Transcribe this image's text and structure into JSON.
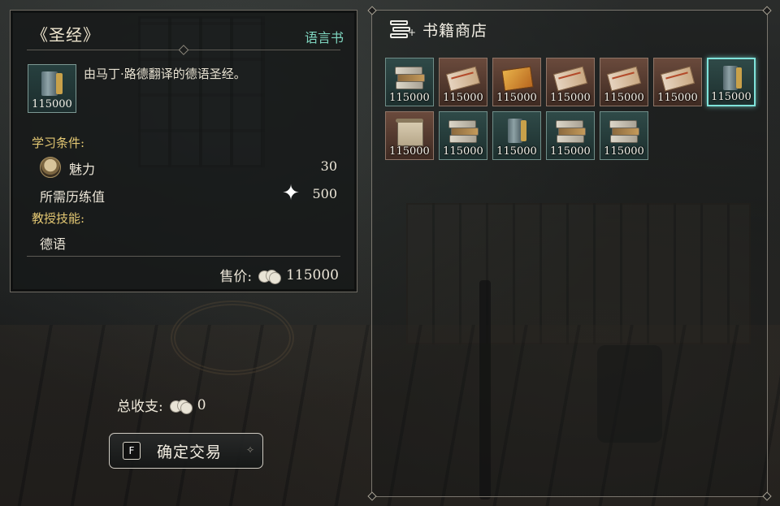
{
  "item_panel": {
    "title": "《圣经》",
    "category": "语言书",
    "description": "由马丁·路德翻译的德语圣经。",
    "thumb_price": "115000",
    "requirements_heading": "学习条件:",
    "charm_label": "魅力",
    "charm_value": "30",
    "exp_label": "所需历练值",
    "exp_value": "500",
    "skill_heading": "教授技能:",
    "skill_value": "德语",
    "price_label": "售价:",
    "price_value": "115000"
  },
  "footer": {
    "total_label": "总收支:",
    "total_value": "0",
    "confirm_key": "F",
    "confirm_label": "确定交易"
  },
  "shop": {
    "title": "书籍商店",
    "items": [
      {
        "price": "115000",
        "art": "stack"
      },
      {
        "price": "115000",
        "art": "scroll"
      },
      {
        "price": "115000",
        "art": "map"
      },
      {
        "price": "115000",
        "art": "scroll"
      },
      {
        "price": "115000",
        "art": "scroll"
      },
      {
        "price": "115000",
        "art": "scroll"
      },
      {
        "price": "115000",
        "art": "bible",
        "selected": true
      },
      {
        "price": "115000",
        "art": "parch"
      },
      {
        "price": "115000",
        "art": "stack"
      },
      {
        "price": "115000",
        "art": "bible"
      },
      {
        "price": "115000",
        "art": "stack"
      },
      {
        "price": "115000",
        "art": "stack"
      }
    ]
  },
  "colors": {
    "accent_teal": "#7fd6c0",
    "heading_gold": "#e4c873",
    "selected_border": "#7fe3da"
  },
  "icons": [
    "books-icon",
    "charm-icon",
    "star-icon",
    "coin-icon",
    "key-f-icon"
  ]
}
